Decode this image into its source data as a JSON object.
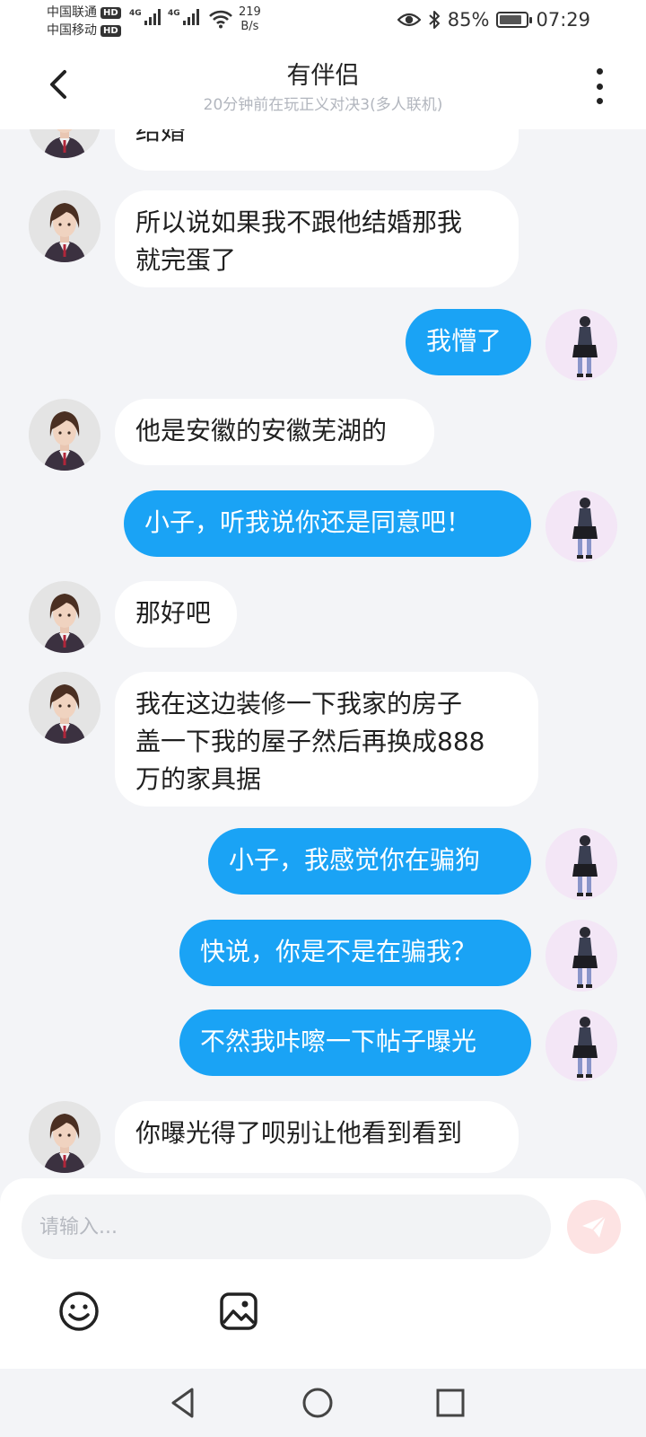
{
  "status_bar": {
    "carrier1": "中国联通",
    "carrier2": "中国移动",
    "hd": "HD",
    "net1": "4G",
    "net2": "4G",
    "speed_value": "219",
    "speed_unit": "B/s",
    "battery": "85%",
    "battery_level": 0.85,
    "time": "07:29"
  },
  "header": {
    "title": "有伴侣",
    "subtitle": "20分钟前在玩正义对决3(多人联机)"
  },
  "messages": [
    {
      "side": "left",
      "text": "结婚"
    },
    {
      "side": "left",
      "text": "所以说如果我不跟他结婚那我\n就完蛋了"
    },
    {
      "side": "right",
      "text": "我懵了"
    },
    {
      "side": "left",
      "text": "他是安徽的安徽芜湖的"
    },
    {
      "side": "right",
      "text": "小子，听我说你还是同意吧！"
    },
    {
      "side": "left",
      "text": "那好吧"
    },
    {
      "side": "left",
      "text": " 我在这边装修一下我家的房子\n盖一下我的屋子然后再换成888\n万的家具据"
    },
    {
      "side": "right",
      "text": "小子，我感觉你在骗狗"
    },
    {
      "side": "right",
      "text": "快说，你是不是在骗我？"
    },
    {
      "side": "right",
      "text": "不然我咔嚓一下帖子曝光"
    },
    {
      "side": "left",
      "text": "你曝光得了呗别让他看到看到"
    }
  ],
  "composer": {
    "placeholder": "请输入..."
  },
  "icons": {
    "back": "chevron-left-icon",
    "more": "more-vertical-icon",
    "send": "send-icon",
    "emoji": "smile-icon",
    "image": "image-icon",
    "nav_back": "triangle-back-icon",
    "nav_home": "circle-home-icon",
    "nav_recent": "square-recent-icon"
  },
  "colors": {
    "accent_bubble": "#1aa3f5",
    "incoming_bubble": "#ffffff",
    "background": "#f3f4f7",
    "send_button": "#fde3e3"
  }
}
